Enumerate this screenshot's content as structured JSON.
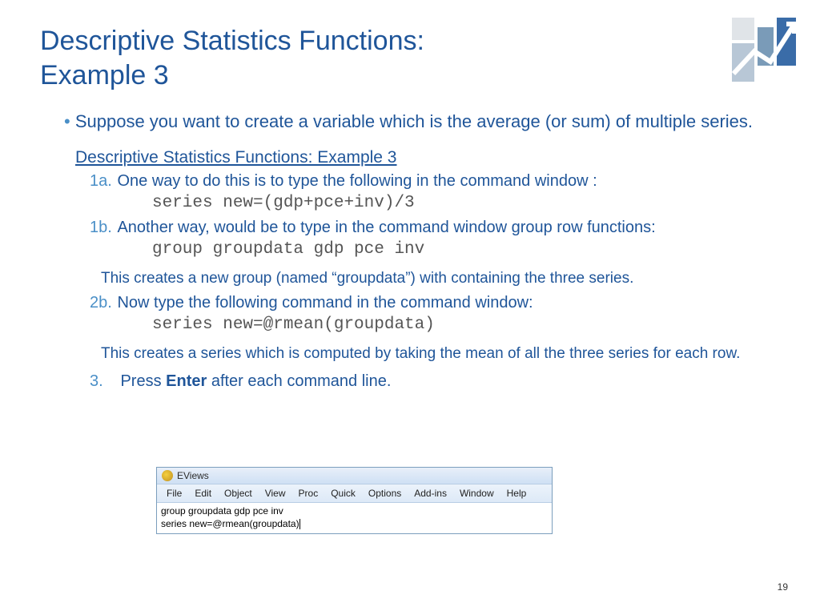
{
  "title_line1": "Descriptive Statistics Functions:",
  "title_line2": "Example 3",
  "intro": "Suppose you want to create a variable which is the average (or sum) of multiple series.",
  "subtitle": "Descriptive Statistics Functions: Example 3",
  "steps": {
    "s1a_label": "1a.",
    "s1a_text": "One way to do this is to type the following in the command window :",
    "s1a_code": "series new=(gdp+pce+inv)/3",
    "s1b_label": "1b.",
    "s1b_text": "Another way, would be to type in the command window group row functions:",
    "s1b_code": "group groupdata gdp pce inv",
    "note1": "This creates a new group (named “groupdata”) with containing the three series.",
    "s2b_label": "2b.",
    "s2b_text": "Now type the following command in the command window:",
    "s2b_code": "series new=@rmean(groupdata)",
    "note2": "This creates a series  which is computed by taking the mean of all the three series for each row.",
    "s3_label": "3.",
    "s3_text_pre": "Press ",
    "s3_text_bold": "Enter",
    "s3_text_post": " after each command line."
  },
  "eviews": {
    "title": "EViews",
    "menu": [
      "File",
      "Edit",
      "Object",
      "View",
      "Proc",
      "Quick",
      "Options",
      "Add-ins",
      "Window",
      "Help"
    ],
    "cmd_line1": "group groupdata gdp pce inv",
    "cmd_line2": "series new=@rmean(groupdata)"
  },
  "page_number": "19"
}
